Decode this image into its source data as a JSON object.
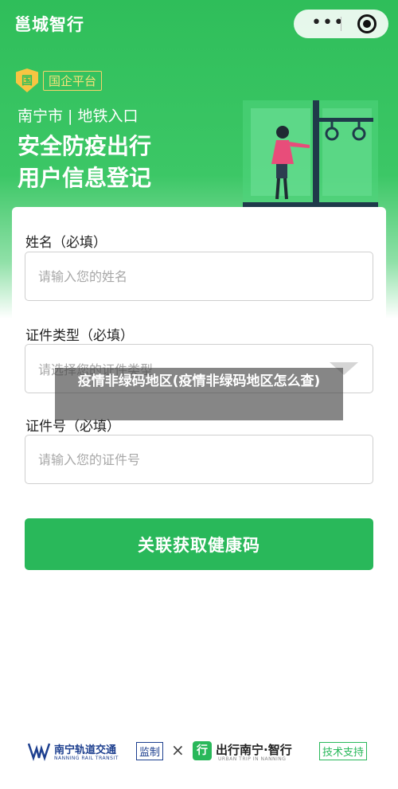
{
  "header": {
    "app_title": "邕城智行",
    "more_icon": "more-dots-icon",
    "close_icon": "target-close-icon"
  },
  "banner": {
    "badge_icon_text": "国",
    "badge_text": "国企平台",
    "subtitle": "南宁市 | 地铁入口",
    "headline_line1": "安全防疫出行",
    "headline_line2": "用户信息登记"
  },
  "form": {
    "name_label": "姓名（必填）",
    "name_placeholder": "请输入您的姓名",
    "id_type_label": "证件类型（必填）",
    "id_type_placeholder": "请选择您的证件类型",
    "id_number_label": "证件号（必填）",
    "id_number_placeholder": "请输入您的证件号",
    "submit_label": "关联获取健康码"
  },
  "overlay": {
    "caption": "疫情非绿码地区(疫情非绿码地区怎么查)"
  },
  "footer": {
    "brand_a": "南宁轨道交通",
    "brand_a_en": "NANNING RAIL TRANSIT",
    "tag_a": "监制",
    "separator": "×",
    "brand_b_logo": "行",
    "brand_b": "出行南宁·智行",
    "brand_b_en": "URBAN TRIP IN NANNING",
    "tag_b": "技术支持"
  },
  "colors": {
    "primary_green": "#29b85a",
    "banner_green": "#2fbe5a",
    "badge_yellow": "#f7c542",
    "transit_blue": "#1d3f8f"
  }
}
